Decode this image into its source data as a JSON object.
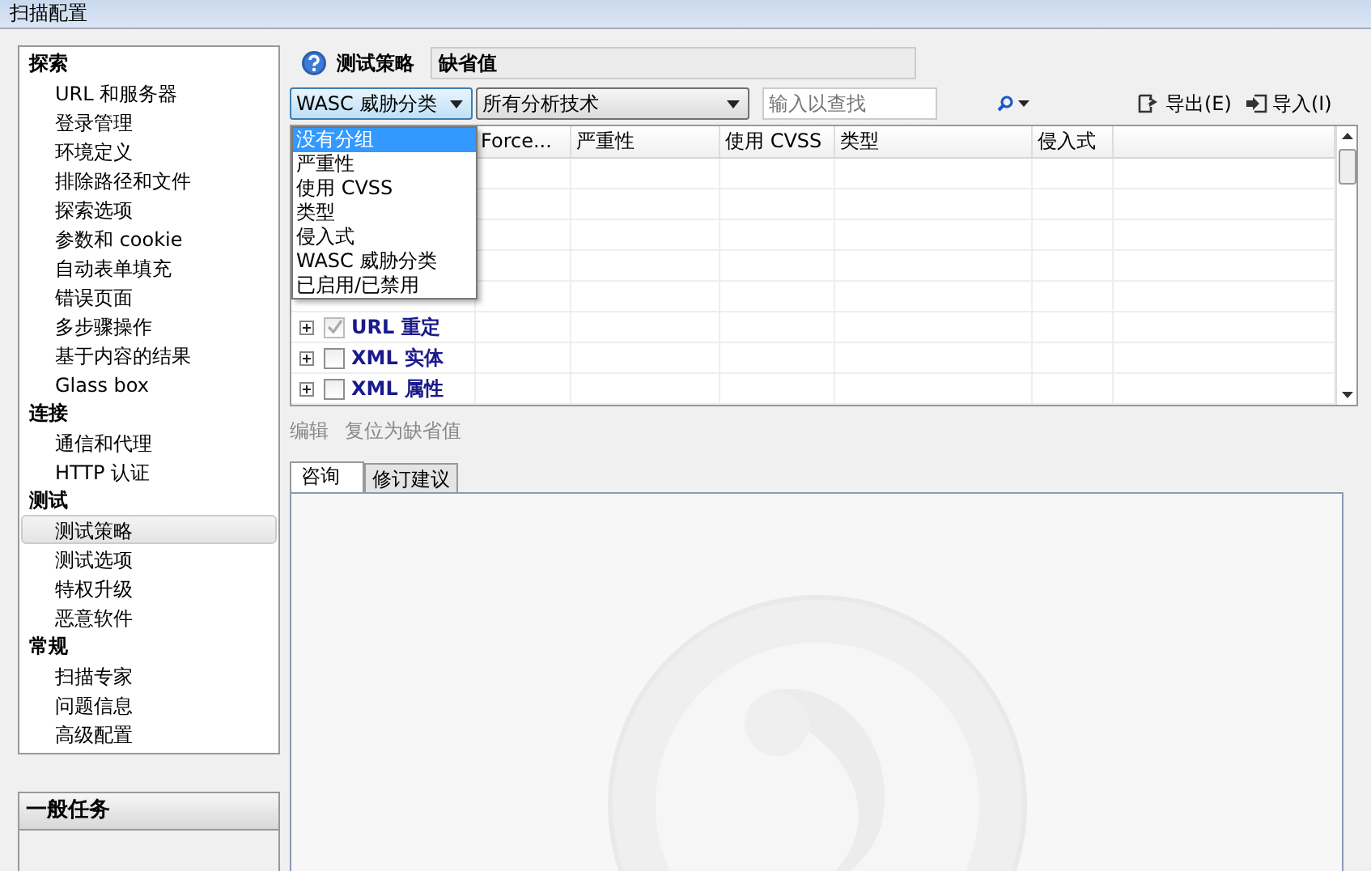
{
  "window": {
    "title": "扫描配置"
  },
  "sidebar": {
    "sections": [
      {
        "label": "探索",
        "items": [
          {
            "label": "URL 和服务器",
            "selected": false
          },
          {
            "label": "登录管理",
            "selected": false
          },
          {
            "label": "环境定义",
            "selected": false
          },
          {
            "label": "排除路径和文件",
            "selected": false
          },
          {
            "label": "探索选项",
            "selected": false
          },
          {
            "label": "参数和 cookie",
            "selected": false
          },
          {
            "label": "自动表单填充",
            "selected": false
          },
          {
            "label": "错误页面",
            "selected": false
          },
          {
            "label": "多步骤操作",
            "selected": false
          },
          {
            "label": "基于内容的结果",
            "selected": false
          },
          {
            "label": "Glass box",
            "selected": false
          }
        ]
      },
      {
        "label": "连接",
        "items": [
          {
            "label": "通信和代理",
            "selected": false
          },
          {
            "label": "HTTP 认证",
            "selected": false
          }
        ]
      },
      {
        "label": "测试",
        "items": [
          {
            "label": "测试策略",
            "selected": true
          },
          {
            "label": "测试选项",
            "selected": false
          },
          {
            "label": "特权升级",
            "selected": false
          },
          {
            "label": "恶意软件",
            "selected": false
          }
        ]
      },
      {
        "label": "常规",
        "items": [
          {
            "label": "扫描专家",
            "selected": false
          },
          {
            "label": "问题信息",
            "selected": false
          },
          {
            "label": "高级配置",
            "selected": false
          }
        ]
      }
    ]
  },
  "tasks_panel": {
    "title": "一般任务"
  },
  "policy": {
    "label": "测试策略",
    "value": "缺省值"
  },
  "toolbar": {
    "group_by": "WASC 威胁分类",
    "technique": "所有分析技术",
    "search": {
      "placeholder": "输入以查找"
    },
    "export": "导出(E)",
    "import": "导入(I)"
  },
  "group_menu": [
    {
      "label": "没有分组",
      "selected": true
    },
    {
      "label": "严重性",
      "selected": false
    },
    {
      "label": "使用 CVSS",
      "selected": false
    },
    {
      "label": "类型",
      "selected": false
    },
    {
      "label": "侵入式",
      "selected": false
    },
    {
      "label": "WASC 威胁分类",
      "selected": false
    },
    {
      "label": "已启用/已禁用",
      "selected": false
    }
  ],
  "table": {
    "columns": [
      "Force...",
      "严重性",
      "使用 CVSS",
      "类型",
      "侵入式"
    ],
    "rows": [
      {
        "name": "URL 重定",
        "checked": true
      },
      {
        "name": "XML 实体",
        "checked": false
      },
      {
        "name": "XML 属性",
        "checked": false
      }
    ]
  },
  "actions": [
    {
      "label": "编辑",
      "disabled": true
    },
    {
      "label": "复位为缺省值",
      "disabled": true
    }
  ],
  "detail_tabs": [
    {
      "label": "咨询",
      "selected": true
    },
    {
      "label": "修订建议",
      "selected": false
    }
  ]
}
